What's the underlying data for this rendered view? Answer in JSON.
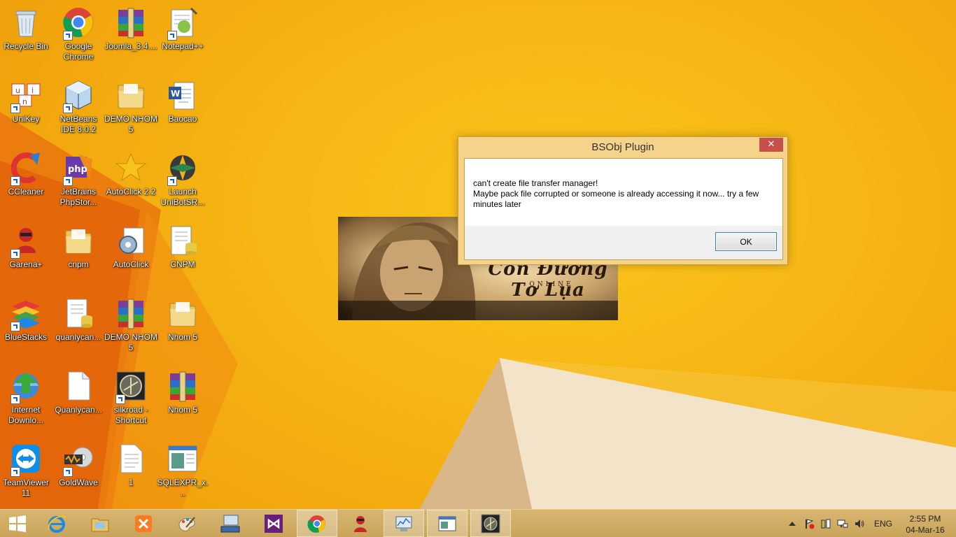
{
  "colors": {
    "wallpaper_main": "#f6b714",
    "wallpaper_shadow": "#e2660a",
    "dialog_frame": "#f5d38a",
    "dialog_close": "#c7504a",
    "taskbar": "#d8b671",
    "ok_border": "#3c7fb1"
  },
  "desktop": {
    "icons": [
      {
        "label": "Recycle Bin",
        "icon": "recycle-bin-icon",
        "shortcut": false
      },
      {
        "label": "Google Chrome",
        "icon": "chrome-icon",
        "shortcut": true
      },
      {
        "label": "Joomla_3.4....",
        "icon": "winrar-archive-icon",
        "shortcut": false
      },
      {
        "label": "Notepad++",
        "icon": "notepadpp-icon",
        "shortcut": true
      },
      {
        "label": "UniKey",
        "icon": "unikey-icon",
        "shortcut": true
      },
      {
        "label": "NetBeans IDE 8.0.2",
        "icon": "netbeans-icon",
        "shortcut": true
      },
      {
        "label": "DEMO NHOM 5",
        "icon": "folder-icon",
        "shortcut": false
      },
      {
        "label": "Baocao",
        "icon": "word-document-icon",
        "shortcut": false
      },
      {
        "label": "CCleaner",
        "icon": "ccleaner-icon",
        "shortcut": true
      },
      {
        "label": "JetBrains PhpStor...",
        "icon": "phpstorm-icon",
        "shortcut": true
      },
      {
        "label": "AutoClick 2.2",
        "icon": "star-icon",
        "shortcut": false
      },
      {
        "label": "Launch UniBotSR...",
        "icon": "unibot-icon",
        "shortcut": true
      },
      {
        "label": "Garena+",
        "icon": "garena-icon",
        "shortcut": true
      },
      {
        "label": "cnpm",
        "icon": "folder-icon",
        "shortcut": false
      },
      {
        "label": "AutoClick",
        "icon": "autoclick-gear-icon",
        "shortcut": false
      },
      {
        "label": "CNPM",
        "icon": "database-file-icon",
        "shortcut": false
      },
      {
        "label": "BlueStacks",
        "icon": "bluestacks-icon",
        "shortcut": true
      },
      {
        "label": "quanlycan...",
        "icon": "database-file-icon",
        "shortcut": false
      },
      {
        "label": "DEMO NHOM 5",
        "icon": "winrar-archive-icon",
        "shortcut": false
      },
      {
        "label": "Nhom 5",
        "icon": "folder-icon",
        "shortcut": false
      },
      {
        "label": "Internet Downlo...",
        "icon": "idm-icon",
        "shortcut": true
      },
      {
        "label": "Quanlycan...",
        "icon": "blank-file-icon",
        "shortcut": false
      },
      {
        "label": "silkroad - Shortcut",
        "icon": "silkroad-icon",
        "shortcut": true
      },
      {
        "label": "Nhom 5",
        "icon": "winrar-archive-icon",
        "shortcut": false
      },
      {
        "label": "TeamViewer 11",
        "icon": "teamviewer-icon",
        "shortcut": true
      },
      {
        "label": "GoldWave",
        "icon": "goldwave-icon",
        "shortcut": true
      },
      {
        "label": "1",
        "icon": "text-file-icon",
        "shortcut": false
      },
      {
        "label": "SQLEXPR_x...",
        "icon": "installer-window-icon",
        "shortcut": false
      }
    ]
  },
  "splash": {
    "logo_text": "Con Đường Tơ Lụa",
    "sub_text": "ONLINE"
  },
  "dialog": {
    "title": "BSObj Plugin",
    "close_glyph": "✕",
    "message": "can't create file transfer manager!\nMaybe pack file corrupted or someone is already accessing it now... try a few minutes later",
    "ok_label": "OK"
  },
  "taskbar": {
    "pinned": [
      {
        "icon": "internet-explorer-icon",
        "running": false
      },
      {
        "icon": "file-explorer-icon",
        "running": false
      },
      {
        "icon": "xampp-icon",
        "running": false
      },
      {
        "icon": "paint-icon",
        "running": false
      },
      {
        "icon": "keyboard-monitor-icon",
        "running": false
      },
      {
        "icon": "visual-studio-icon",
        "running": false
      },
      {
        "icon": "chrome-icon",
        "running": true
      },
      {
        "icon": "garena-icon",
        "running": false
      },
      {
        "icon": "resource-monitor-icon",
        "running": true
      },
      {
        "icon": "window-app-icon",
        "running": true
      },
      {
        "icon": "silkroad-icon",
        "running": true
      }
    ],
    "tray": {
      "language": "ENG",
      "time": "2:55 PM",
      "date": "04-Mar-16"
    }
  }
}
